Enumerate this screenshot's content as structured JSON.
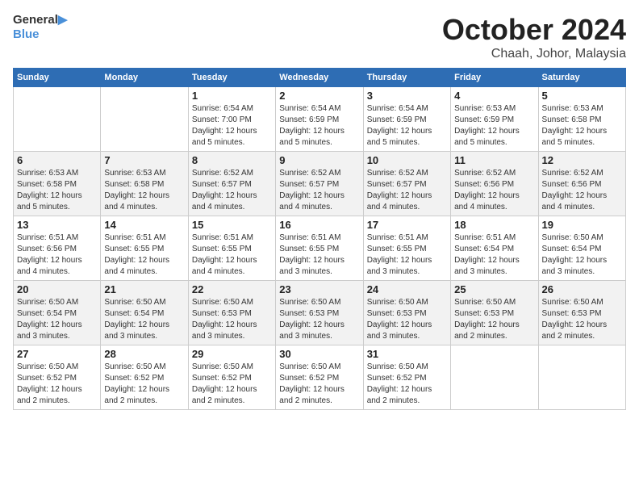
{
  "logo": {
    "line1": "General",
    "line2": "Blue"
  },
  "title": "October 2024",
  "subtitle": "Chaah, Johor, Malaysia",
  "days_of_week": [
    "Sunday",
    "Monday",
    "Tuesday",
    "Wednesday",
    "Thursday",
    "Friday",
    "Saturday"
  ],
  "weeks": [
    [
      {
        "day": "",
        "info": ""
      },
      {
        "day": "",
        "info": ""
      },
      {
        "day": "1",
        "info": "Sunrise: 6:54 AM\nSunset: 7:00 PM\nDaylight: 12 hours\nand 5 minutes."
      },
      {
        "day": "2",
        "info": "Sunrise: 6:54 AM\nSunset: 6:59 PM\nDaylight: 12 hours\nand 5 minutes."
      },
      {
        "day": "3",
        "info": "Sunrise: 6:54 AM\nSunset: 6:59 PM\nDaylight: 12 hours\nand 5 minutes."
      },
      {
        "day": "4",
        "info": "Sunrise: 6:53 AM\nSunset: 6:59 PM\nDaylight: 12 hours\nand 5 minutes."
      },
      {
        "day": "5",
        "info": "Sunrise: 6:53 AM\nSunset: 6:58 PM\nDaylight: 12 hours\nand 5 minutes."
      }
    ],
    [
      {
        "day": "6",
        "info": "Sunrise: 6:53 AM\nSunset: 6:58 PM\nDaylight: 12 hours\nand 5 minutes."
      },
      {
        "day": "7",
        "info": "Sunrise: 6:53 AM\nSunset: 6:58 PM\nDaylight: 12 hours\nand 4 minutes."
      },
      {
        "day": "8",
        "info": "Sunrise: 6:52 AM\nSunset: 6:57 PM\nDaylight: 12 hours\nand 4 minutes."
      },
      {
        "day": "9",
        "info": "Sunrise: 6:52 AM\nSunset: 6:57 PM\nDaylight: 12 hours\nand 4 minutes."
      },
      {
        "day": "10",
        "info": "Sunrise: 6:52 AM\nSunset: 6:57 PM\nDaylight: 12 hours\nand 4 minutes."
      },
      {
        "day": "11",
        "info": "Sunrise: 6:52 AM\nSunset: 6:56 PM\nDaylight: 12 hours\nand 4 minutes."
      },
      {
        "day": "12",
        "info": "Sunrise: 6:52 AM\nSunset: 6:56 PM\nDaylight: 12 hours\nand 4 minutes."
      }
    ],
    [
      {
        "day": "13",
        "info": "Sunrise: 6:51 AM\nSunset: 6:56 PM\nDaylight: 12 hours\nand 4 minutes."
      },
      {
        "day": "14",
        "info": "Sunrise: 6:51 AM\nSunset: 6:55 PM\nDaylight: 12 hours\nand 4 minutes."
      },
      {
        "day": "15",
        "info": "Sunrise: 6:51 AM\nSunset: 6:55 PM\nDaylight: 12 hours\nand 4 minutes."
      },
      {
        "day": "16",
        "info": "Sunrise: 6:51 AM\nSunset: 6:55 PM\nDaylight: 12 hours\nand 3 minutes."
      },
      {
        "day": "17",
        "info": "Sunrise: 6:51 AM\nSunset: 6:55 PM\nDaylight: 12 hours\nand 3 minutes."
      },
      {
        "day": "18",
        "info": "Sunrise: 6:51 AM\nSunset: 6:54 PM\nDaylight: 12 hours\nand 3 minutes."
      },
      {
        "day": "19",
        "info": "Sunrise: 6:50 AM\nSunset: 6:54 PM\nDaylight: 12 hours\nand 3 minutes."
      }
    ],
    [
      {
        "day": "20",
        "info": "Sunrise: 6:50 AM\nSunset: 6:54 PM\nDaylight: 12 hours\nand 3 minutes."
      },
      {
        "day": "21",
        "info": "Sunrise: 6:50 AM\nSunset: 6:54 PM\nDaylight: 12 hours\nand 3 minutes."
      },
      {
        "day": "22",
        "info": "Sunrise: 6:50 AM\nSunset: 6:53 PM\nDaylight: 12 hours\nand 3 minutes."
      },
      {
        "day": "23",
        "info": "Sunrise: 6:50 AM\nSunset: 6:53 PM\nDaylight: 12 hours\nand 3 minutes."
      },
      {
        "day": "24",
        "info": "Sunrise: 6:50 AM\nSunset: 6:53 PM\nDaylight: 12 hours\nand 3 minutes."
      },
      {
        "day": "25",
        "info": "Sunrise: 6:50 AM\nSunset: 6:53 PM\nDaylight: 12 hours\nand 2 minutes."
      },
      {
        "day": "26",
        "info": "Sunrise: 6:50 AM\nSunset: 6:53 PM\nDaylight: 12 hours\nand 2 minutes."
      }
    ],
    [
      {
        "day": "27",
        "info": "Sunrise: 6:50 AM\nSunset: 6:52 PM\nDaylight: 12 hours\nand 2 minutes."
      },
      {
        "day": "28",
        "info": "Sunrise: 6:50 AM\nSunset: 6:52 PM\nDaylight: 12 hours\nand 2 minutes."
      },
      {
        "day": "29",
        "info": "Sunrise: 6:50 AM\nSunset: 6:52 PM\nDaylight: 12 hours\nand 2 minutes."
      },
      {
        "day": "30",
        "info": "Sunrise: 6:50 AM\nSunset: 6:52 PM\nDaylight: 12 hours\nand 2 minutes."
      },
      {
        "day": "31",
        "info": "Sunrise: 6:50 AM\nSunset: 6:52 PM\nDaylight: 12 hours\nand 2 minutes."
      },
      {
        "day": "",
        "info": ""
      },
      {
        "day": "",
        "info": ""
      }
    ]
  ]
}
